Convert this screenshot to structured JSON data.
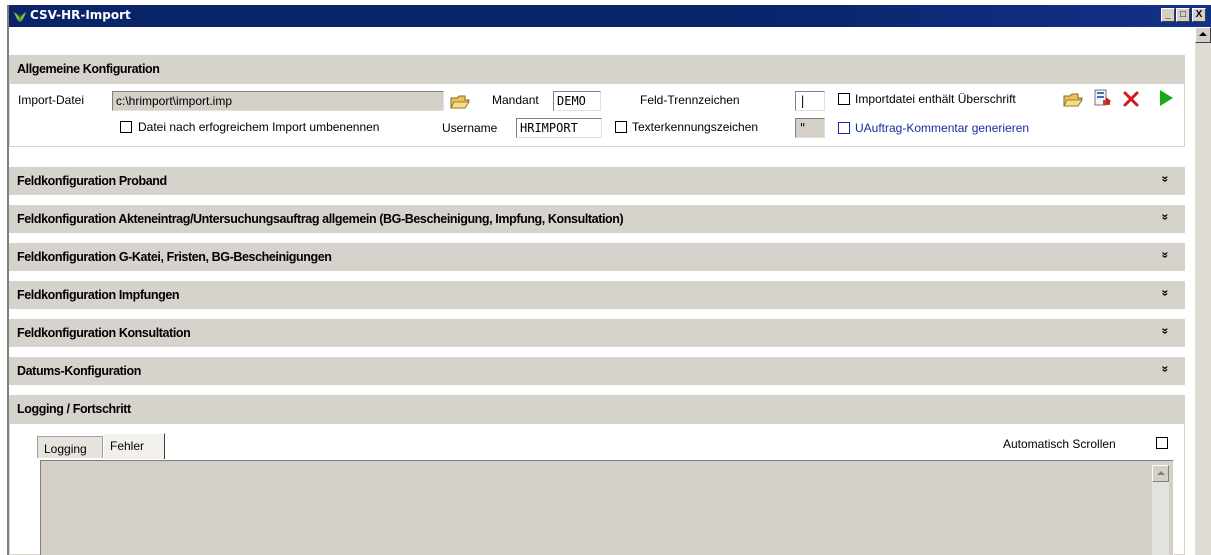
{
  "window": {
    "title": "CSV-HR-Import",
    "controls": {
      "minimize": "_",
      "maximize": "□",
      "close": "X"
    }
  },
  "general": {
    "header": "Allgemeine Konfiguration",
    "import_file_label": "Import-Datei",
    "import_file_value": "c:\\hrimport\\import.imp",
    "rename_checkbox_label": "Datei nach erfogreichem Import umbenennen",
    "rename_checked": false,
    "mandant_label": "Mandant",
    "mandant_value": "DEMO",
    "username_label": "Username",
    "username_value": "HRIMPORT",
    "separator_label": "Feld-Trennzeichen",
    "separator_value": "|",
    "text_qualifier_checkbox_label": "Texterkennungszeichen",
    "text_qualifier_checked": false,
    "text_qualifier_value": "\"",
    "header_checkbox_label": "Importdatei enthält Überschrift",
    "header_checked": false,
    "comment_checkbox_label": "UAuftrag-Kommentar generieren",
    "comment_checked": false
  },
  "sections": [
    {
      "label": "Feldkonfiguration Proband",
      "chevron": "»"
    },
    {
      "label": "Feldkonfiguration Akteneintrag/Untersuchungsauftrag allgemein (BG-Bescheinigung, Impfung, Konsultation)",
      "chevron": "»"
    },
    {
      "label": "Feldkonfiguration G-Katei, Fristen, BG-Bescheinigungen",
      "chevron": "»"
    },
    {
      "label": "Feldkonfiguration Impfungen",
      "chevron": "»"
    },
    {
      "label": "Feldkonfiguration Konsultation",
      "chevron": "»"
    },
    {
      "label": "Datums-Konfiguration",
      "chevron": "»"
    }
  ],
  "logging": {
    "header": "Logging / Fortschritt",
    "tabs": [
      "Logging",
      "Fehler"
    ],
    "active_tab": "Fehler",
    "autoscroll_label": "Automatisch Scrollen",
    "autoscroll_checked": false
  },
  "icons": {
    "app": "leaf-icon",
    "browse": "folder-open-icon",
    "load": "folder-open-icon",
    "save": "save-icon",
    "delete": "delete-icon",
    "run": "play-icon"
  },
  "colors": {
    "title_bar": "#0a246a",
    "section_header": "#d6d2cc",
    "run_green": "#1aa81a",
    "delete_red": "#d01a1a",
    "link_blue": "#1a2aa0"
  }
}
